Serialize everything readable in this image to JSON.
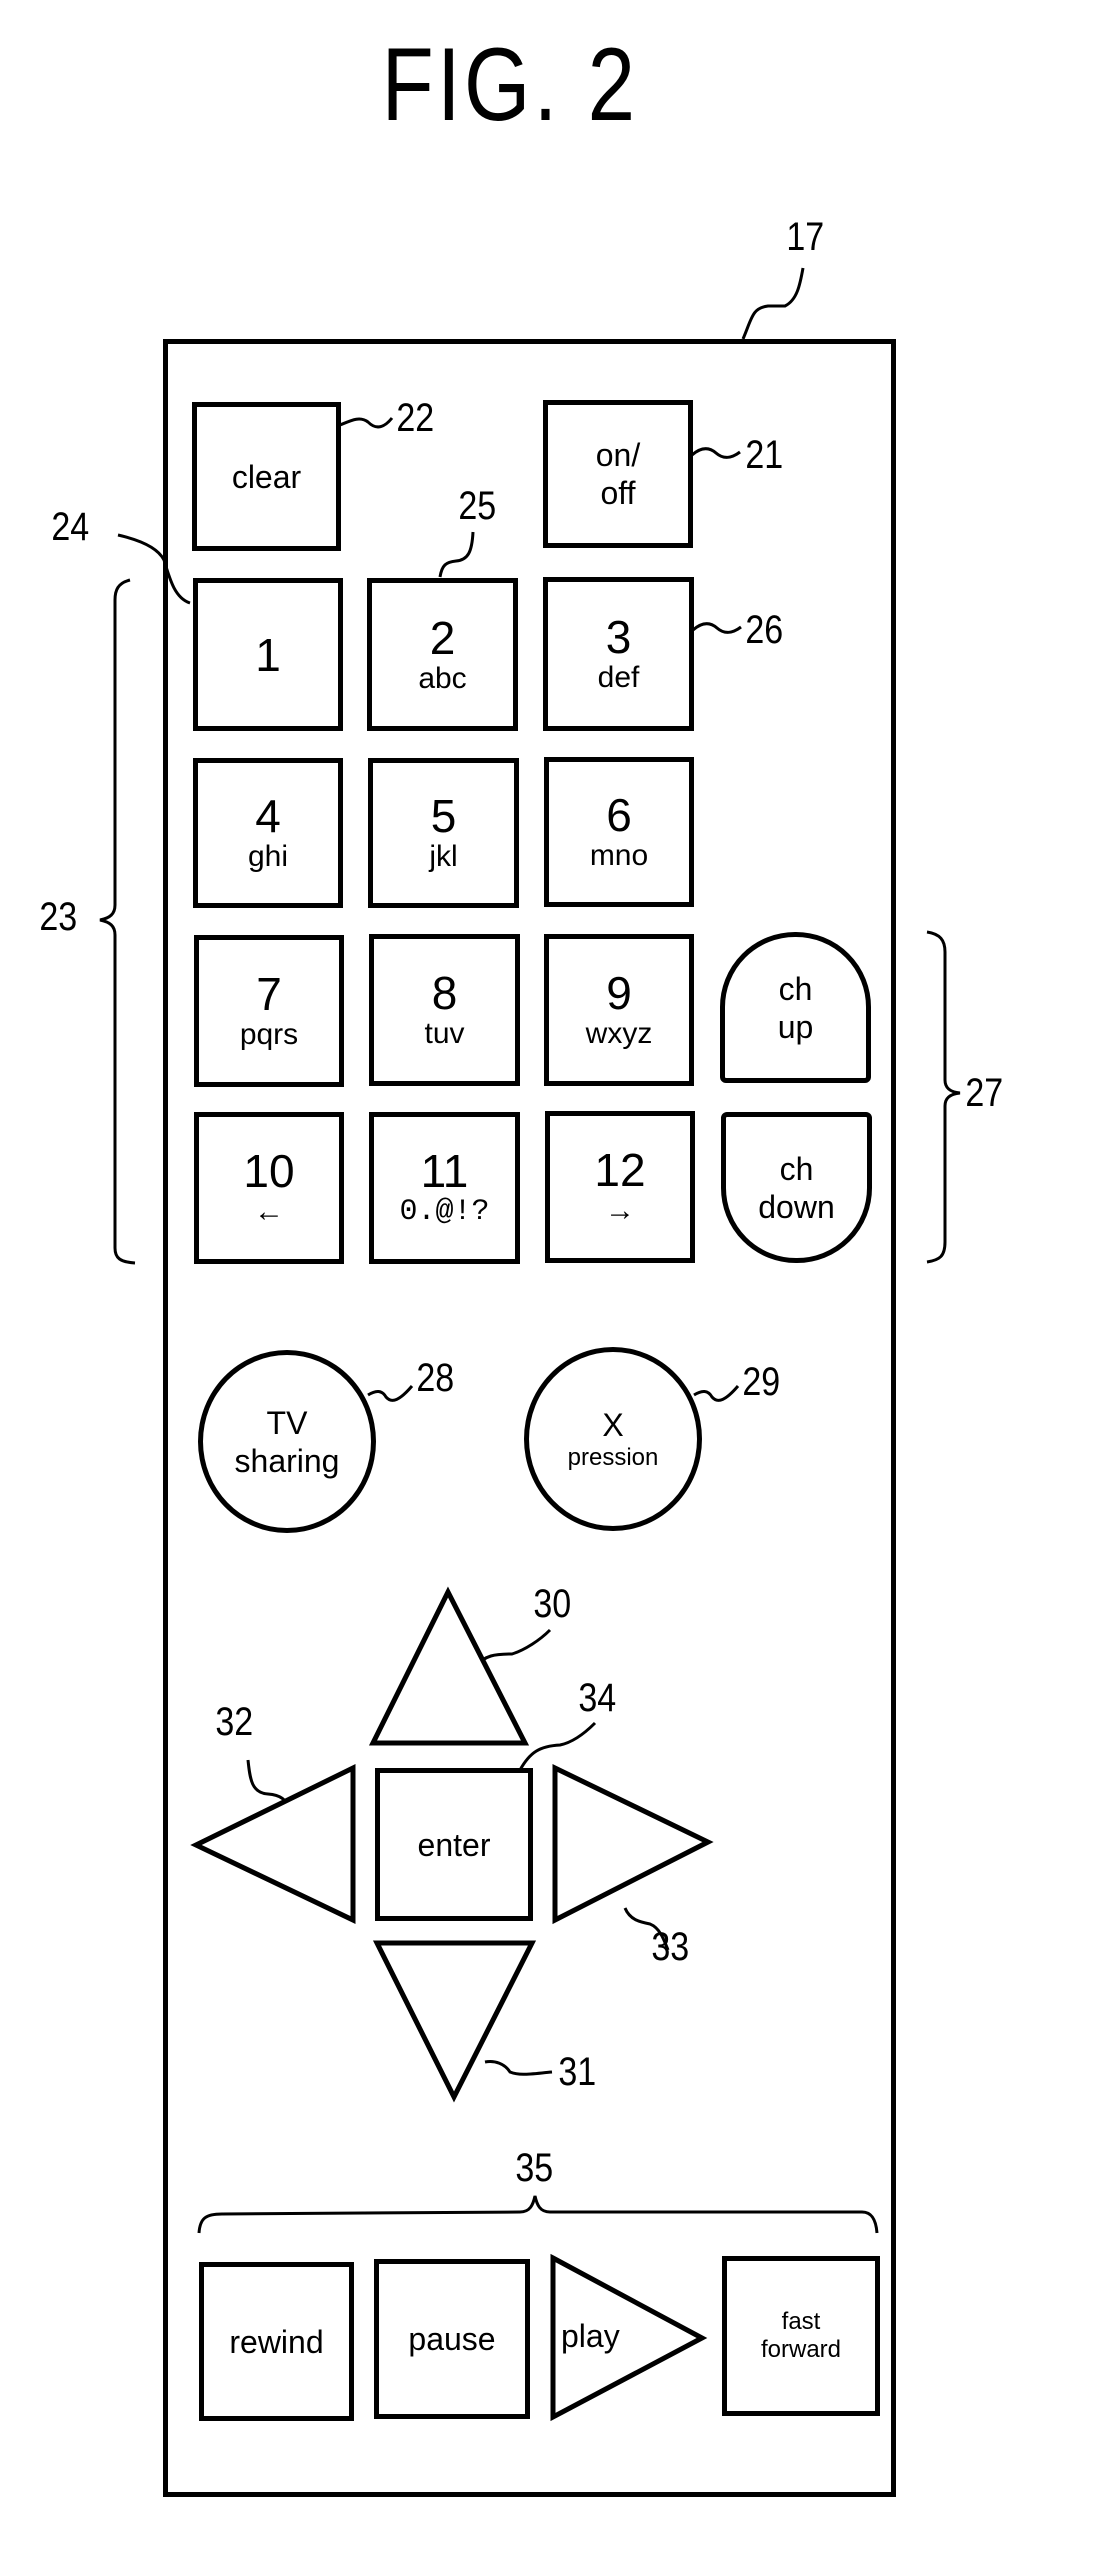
{
  "figure": {
    "title": "FIG. 2",
    "device_ref": "17"
  },
  "top_buttons": {
    "clear": {
      "label": "clear",
      "ref": "22"
    },
    "power": {
      "label": "on/",
      "label2": "off",
      "ref": "21"
    }
  },
  "keypad": {
    "group_ref": "23",
    "key_ref_1": "24",
    "key_ref_2": "25",
    "key_ref_3": "26",
    "keys": [
      {
        "main": "1",
        "sub": ""
      },
      {
        "main": "2",
        "sub": "abc"
      },
      {
        "main": "3",
        "sub": "def"
      },
      {
        "main": "4",
        "sub": "ghi"
      },
      {
        "main": "5",
        "sub": "jkl"
      },
      {
        "main": "6",
        "sub": "mno"
      },
      {
        "main": "7",
        "sub": "pqrs"
      },
      {
        "main": "8",
        "sub": "tuv"
      },
      {
        "main": "9",
        "sub": "wxyz"
      },
      {
        "main": "10",
        "sub": "←"
      },
      {
        "main": "11",
        "sub": "0.@!?"
      },
      {
        "main": "12",
        "sub": "→"
      }
    ]
  },
  "channel": {
    "group_ref": "27",
    "up": {
      "line1": "ch",
      "line2": "up"
    },
    "down": {
      "line1": "ch",
      "line2": "down"
    }
  },
  "special": {
    "tv_sharing": {
      "line1": "TV",
      "line2": "sharing",
      "ref": "28"
    },
    "xpression": {
      "line1": "X",
      "line2": "pression",
      "ref": "29"
    }
  },
  "dpad": {
    "up_ref": "30",
    "down_ref": "31",
    "left_ref": "32",
    "right_ref": "33",
    "enter_ref": "34",
    "enter_label": "enter"
  },
  "transport": {
    "group_ref": "35",
    "rewind": "rewind",
    "pause": "pause",
    "play": "play",
    "fast_forward_line1": "fast",
    "fast_forward_line2": "forward"
  }
}
